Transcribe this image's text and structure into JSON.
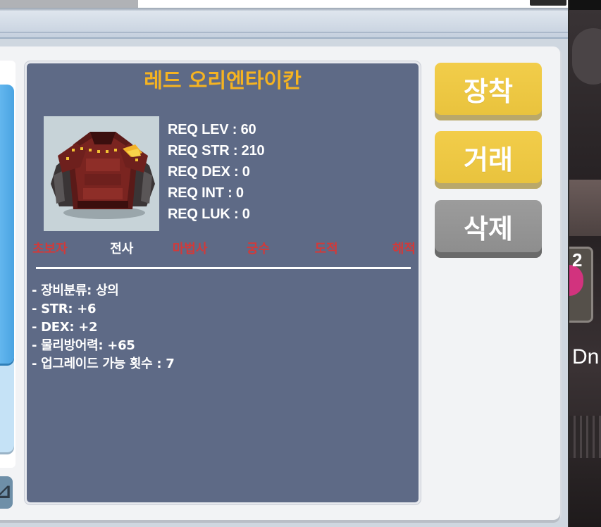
{
  "item": {
    "name": "레드 오리엔타이칸",
    "icon": "red-armor-top-icon",
    "requirements": [
      "REQ LEV : 60",
      "REQ STR : 210",
      "REQ DEX : 0",
      "REQ INT : 0",
      "REQ LUK : 0"
    ],
    "jobs": [
      {
        "label": "초보자",
        "allowed": false
      },
      {
        "label": "전사",
        "allowed": true
      },
      {
        "label": "마법사",
        "allowed": false
      },
      {
        "label": "궁수",
        "allowed": false
      },
      {
        "label": "도적",
        "allowed": false
      },
      {
        "label": "해적",
        "allowed": false
      }
    ],
    "stats": [
      "- 장비분류: 상의",
      "- STR: +6",
      "- DEX: +2",
      "- 물리방어력: +65",
      "- 업그레이드 가능 횟수 : 7"
    ]
  },
  "actions": {
    "equip_label": "장착",
    "trade_label": "거래",
    "delete_label": "삭제"
  },
  "corner_button": {
    "icon": "partial-icon"
  },
  "scene": {
    "count_text": "2",
    "name_text": "Dn"
  },
  "colors": {
    "title": "#f5b321",
    "card_bg": "#5e6a86",
    "disallowed_job": "#d13a3a",
    "button_yellow": "#f2cd4a",
    "button_gray": "#9c9c9c",
    "scroll_blue": "#4aa4e2"
  }
}
